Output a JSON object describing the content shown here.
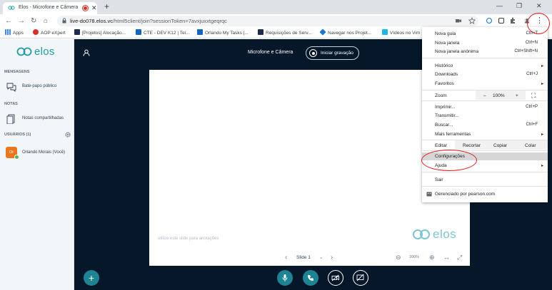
{
  "browser": {
    "tab_title": "Elos - Microfone e Câmera",
    "url_host": "live-do078.elos.vc",
    "url_path": "/html5client/join?sessionToken=7avxjuxxtgeqrqc",
    "bookmarks": [
      "Apps",
      "AOP eXpert",
      "[Projetos] Alocação...",
      "CTE - DEV K12 | Tel...",
      "Orlando My Tasks |...",
      "Requisições de Serv...",
      "Navegar nos Projet...",
      "Vídeos no Vim"
    ],
    "colors": {
      "titlebar": "#dee1e6",
      "accent": "#1a73e8"
    }
  },
  "sidebar": {
    "logo_text": "elos",
    "messages_head": "MENSAGENS",
    "public_chat": "Bate-papo público",
    "notes_head": "NOTAS",
    "shared_notes": "Notas compartilhadas",
    "users_head": "USUÁRIOS (1)",
    "user_initials": "Or",
    "user_name": "Orlando Morais (Você)"
  },
  "main": {
    "title": "Microfone e Câmera",
    "record_label": "Iniciar gravação",
    "slide_note": "utilize este slide para anotações",
    "slide_logo": "elos",
    "slide_label": "Slide 1",
    "zoom": "100%"
  },
  "menu": {
    "new_tab": "Nova guia",
    "new_tab_sc": "Ctrl+T",
    "new_window": "Nova janela",
    "new_window_sc": "Ctrl+N",
    "incognito": "Nova janela anônima",
    "incognito_sc": "Ctrl+Shift+N",
    "history": "Histórico",
    "downloads": "Downloads",
    "downloads_sc": "Ctrl+J",
    "bookmarks": "Favoritos",
    "zoom_label": "Zoom",
    "zoom_minus": "–",
    "zoom_value": "100%",
    "zoom_plus": "+",
    "print": "Imprimir...",
    "print_sc": "Ctrl+P",
    "cast": "Transmitir...",
    "find": "Buscar...",
    "find_sc": "Ctrl+F",
    "more_tools": "Mais ferramentas",
    "edit": "Editar",
    "cut": "Recortar",
    "copy": "Copiar",
    "paste": "Colar",
    "settings": "Configurações",
    "help": "Ajuda",
    "exit": "Sair",
    "managed": "Gerenciado por pearson.com"
  }
}
